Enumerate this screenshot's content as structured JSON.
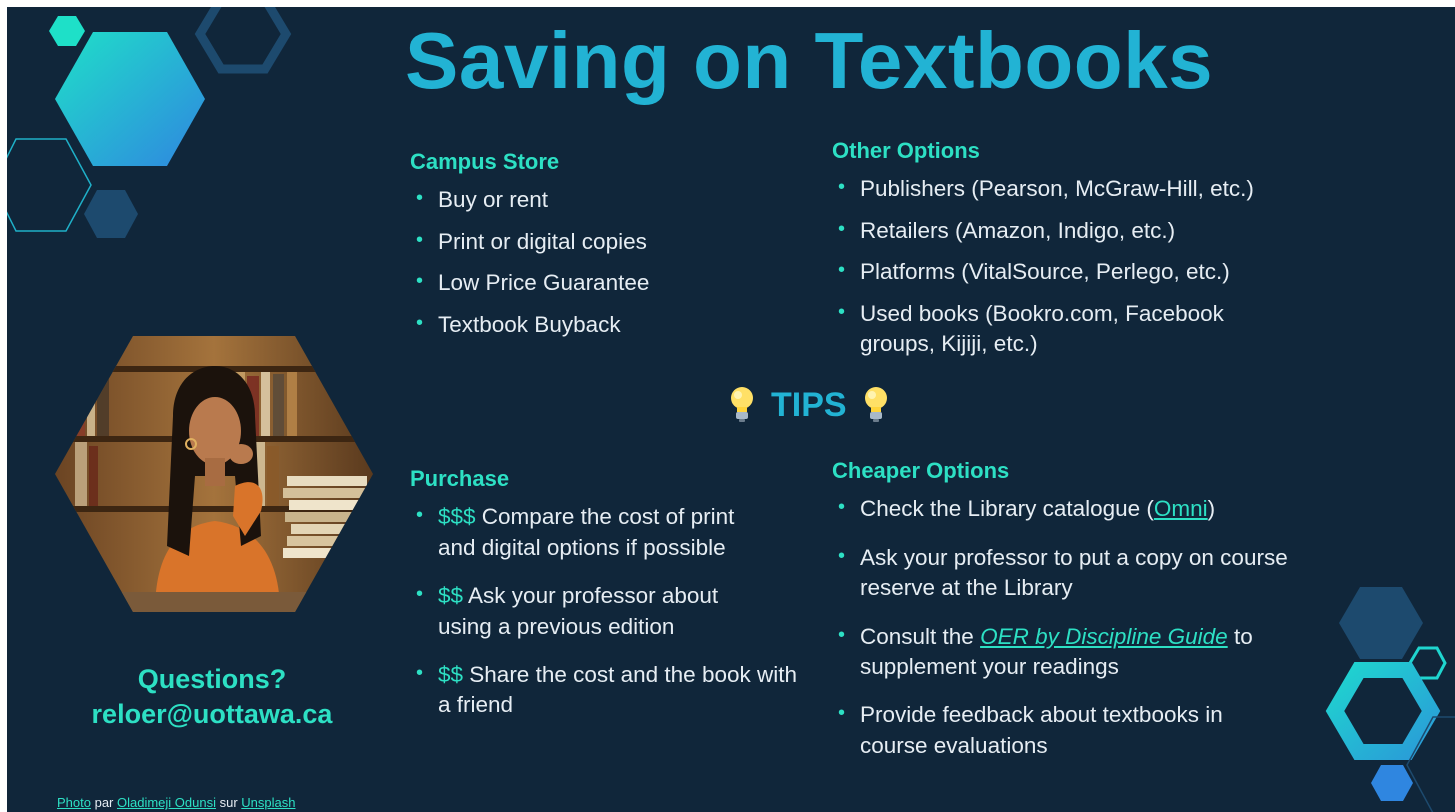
{
  "title": "Saving on Textbooks",
  "campus_store": {
    "heading": "Campus Store",
    "items": [
      "Buy or rent",
      "Print or digital copies",
      "Low Price Guarantee",
      "Textbook Buyback"
    ]
  },
  "other_options": {
    "heading": "Other Options",
    "items": [
      "Publishers (Pearson, McGraw-Hill, etc.)",
      "Retailers (Amazon, Indigo, etc.)",
      "Platforms (VitalSource, Perlego, etc.)",
      "Used books (Bookro.com, Facebook groups, Kijiji, etc.)"
    ]
  },
  "tips": {
    "label": "TIPS",
    "icon": "lightbulb-icon"
  },
  "purchase": {
    "heading": "Purchase",
    "items": [
      {
        "cost": "$$$",
        "text": " Compare the cost of print and digital options if possible"
      },
      {
        "cost": "$$",
        "text": " Ask your professor about using a previous edition"
      },
      {
        "cost": "$$",
        "text": " Share the cost and the book with a friend"
      }
    ]
  },
  "cheaper_options": {
    "heading": "Cheaper Options",
    "item1": {
      "before": "Check the Library catalogue (",
      "link": "Omni",
      "after": ")"
    },
    "item2": {
      "text": "Ask your professor to put a copy on course reserve at the Library"
    },
    "item3": {
      "before": "Consult the ",
      "link": "OER by Discipline Guide",
      "after": " to supplement your readings"
    },
    "item4": {
      "text": "Provide feedback about textbooks in course evaluations"
    }
  },
  "questions": {
    "label": "Questions?",
    "email": "reloer@uottawa.ca"
  },
  "credit": {
    "photo_link": "Photo",
    "par": " par ",
    "author_link": "Oladimeji Odunsi",
    "sur": " sur ",
    "site_link": "Unsplash"
  },
  "colors": {
    "background": "#10263a",
    "title": "#22b3d4",
    "heading": "#2de0c4",
    "text": "#e6edf3",
    "hex_dark": "#1d4a6e",
    "hex_teal": "#1fd5cf",
    "hex_blue": "#2f86e0"
  }
}
